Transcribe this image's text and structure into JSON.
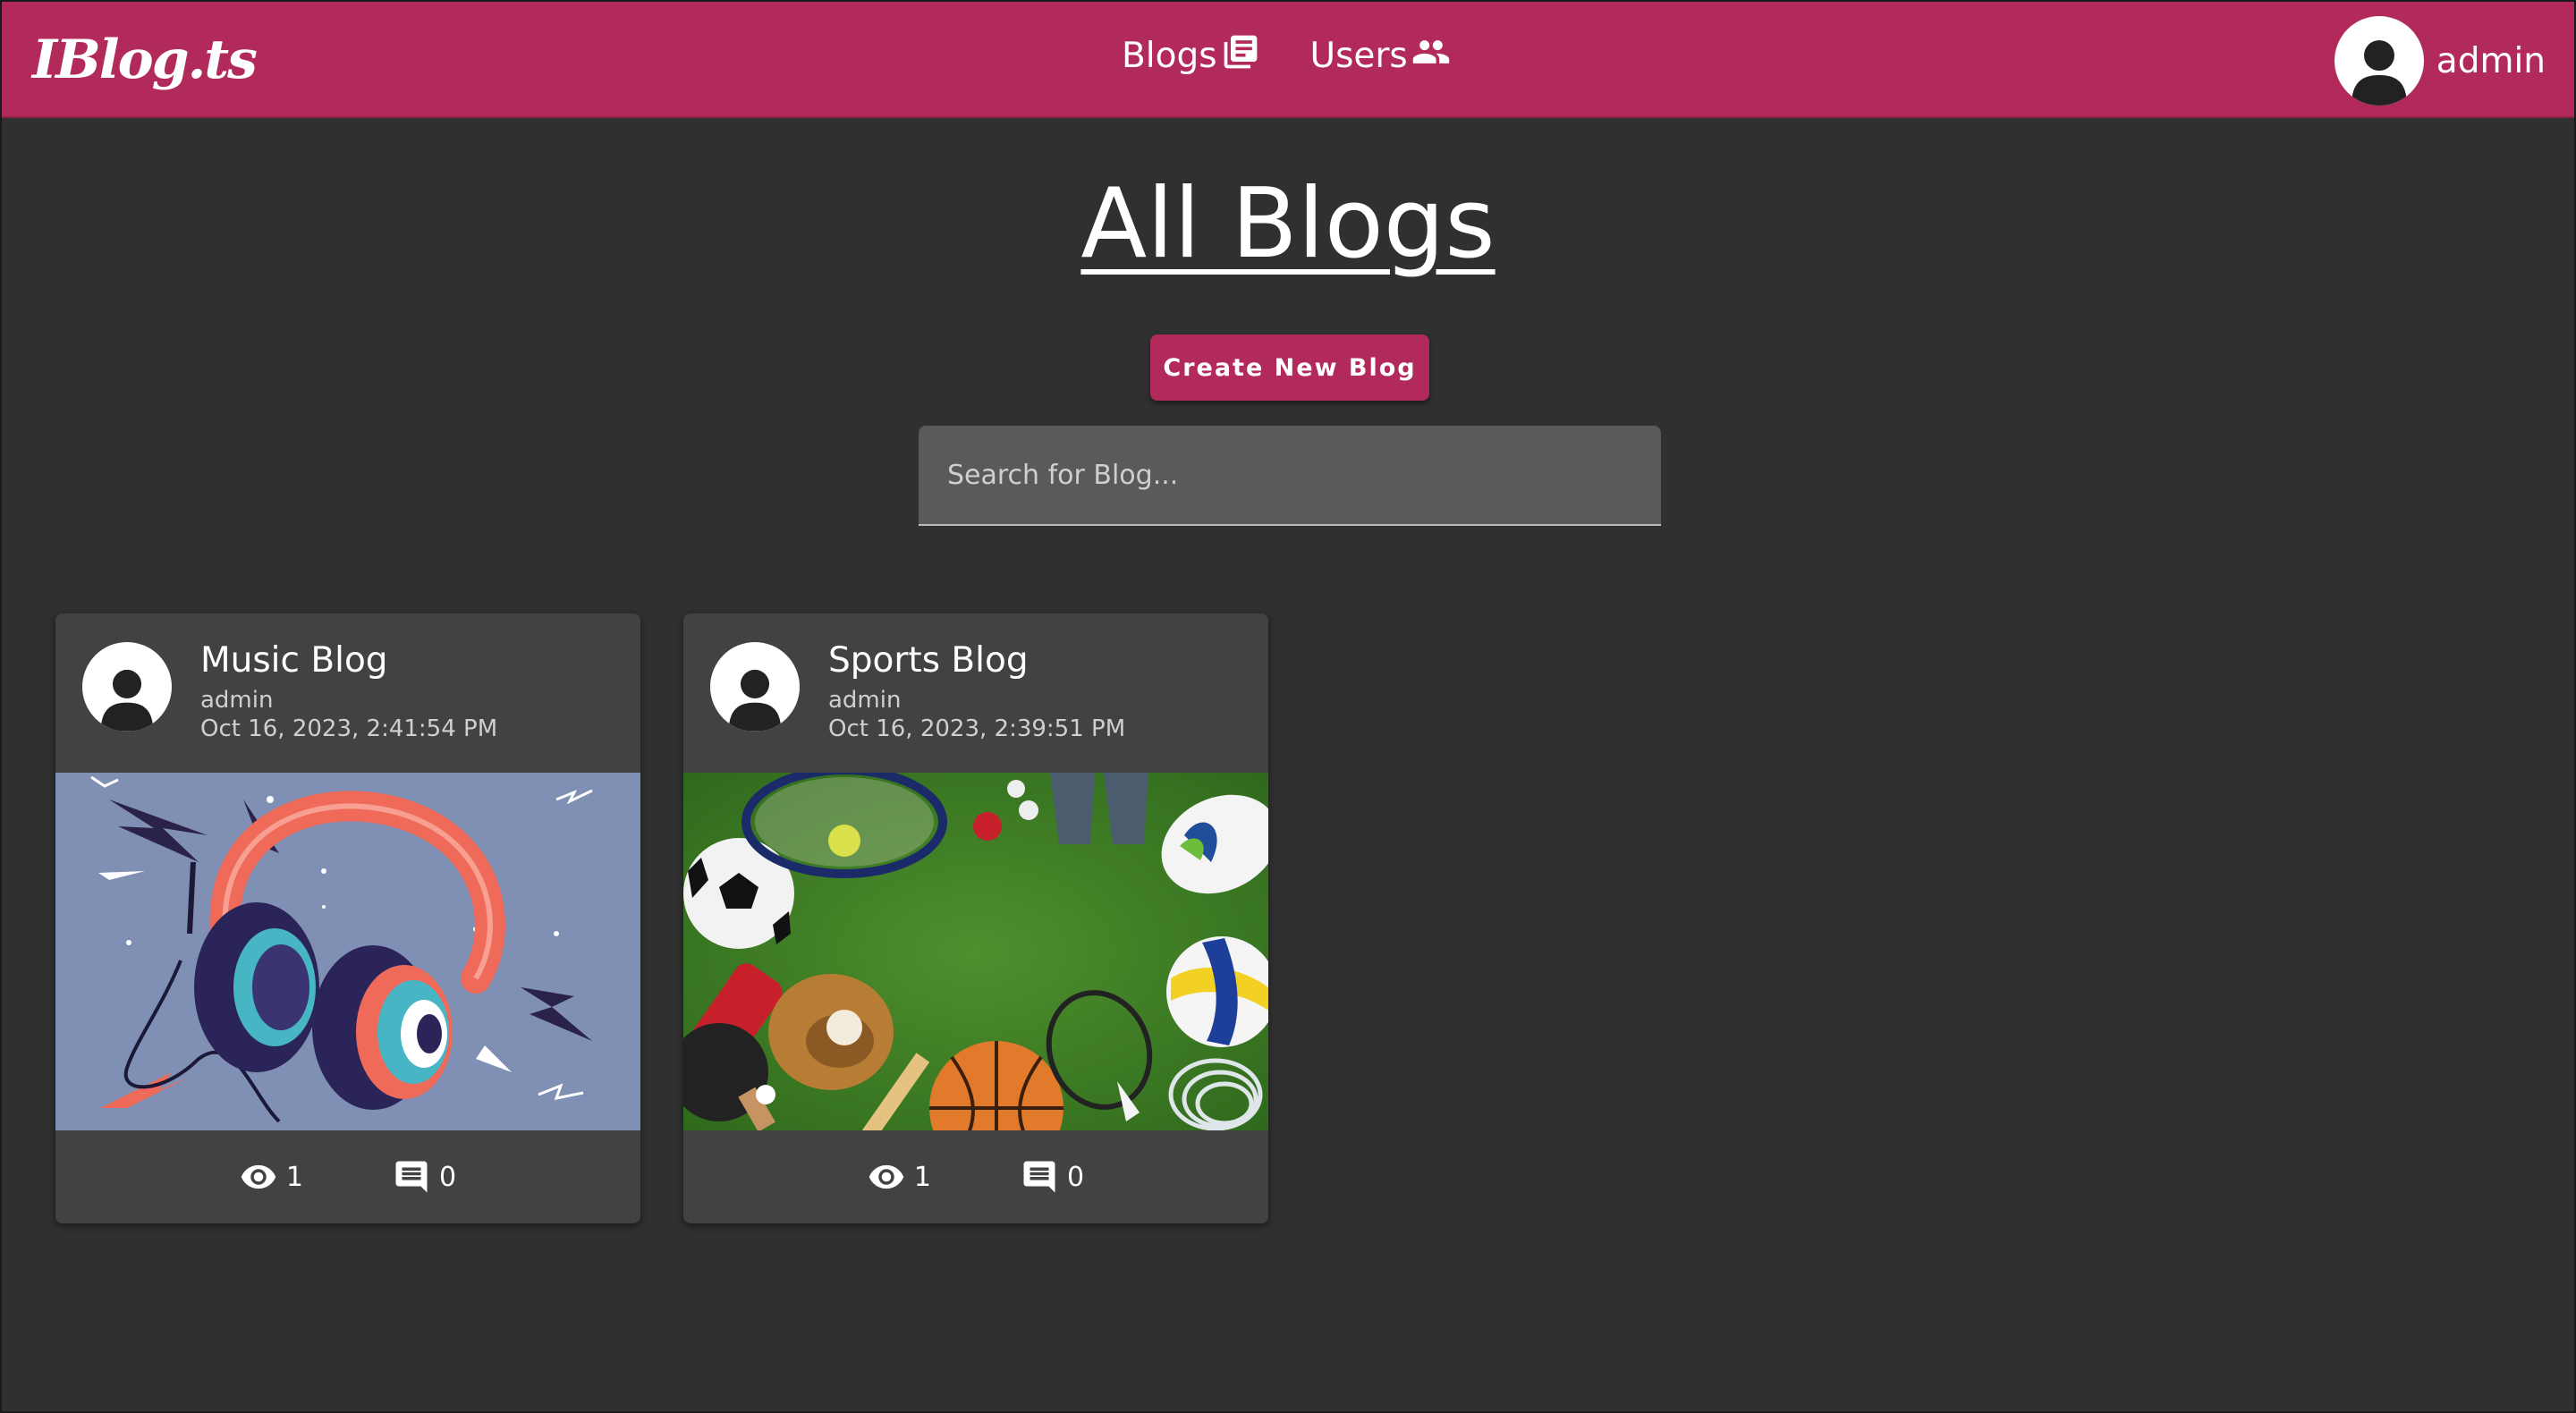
{
  "app": {
    "logo": "IBlog.ts"
  },
  "nav": {
    "blogs": "Blogs",
    "users": "Users"
  },
  "user": {
    "name": "admin"
  },
  "page": {
    "title": "All Blogs",
    "create_label": "Create New Blog",
    "search_placeholder": "Search for Blog..."
  },
  "colors": {
    "accent": "#b22a5b",
    "background": "#303030",
    "card": "#424242"
  },
  "blogs": [
    {
      "title": "Music Blog",
      "author": "admin",
      "date": "Oct 16, 2023, 2:41:54 PM",
      "views": "1",
      "comments": "0",
      "image": "headphones-illustration"
    },
    {
      "title": "Sports Blog",
      "author": "admin",
      "date": "Oct 16, 2023, 2:39:51 PM",
      "views": "1",
      "comments": "0",
      "image": "sports-equipment-on-grass"
    }
  ]
}
